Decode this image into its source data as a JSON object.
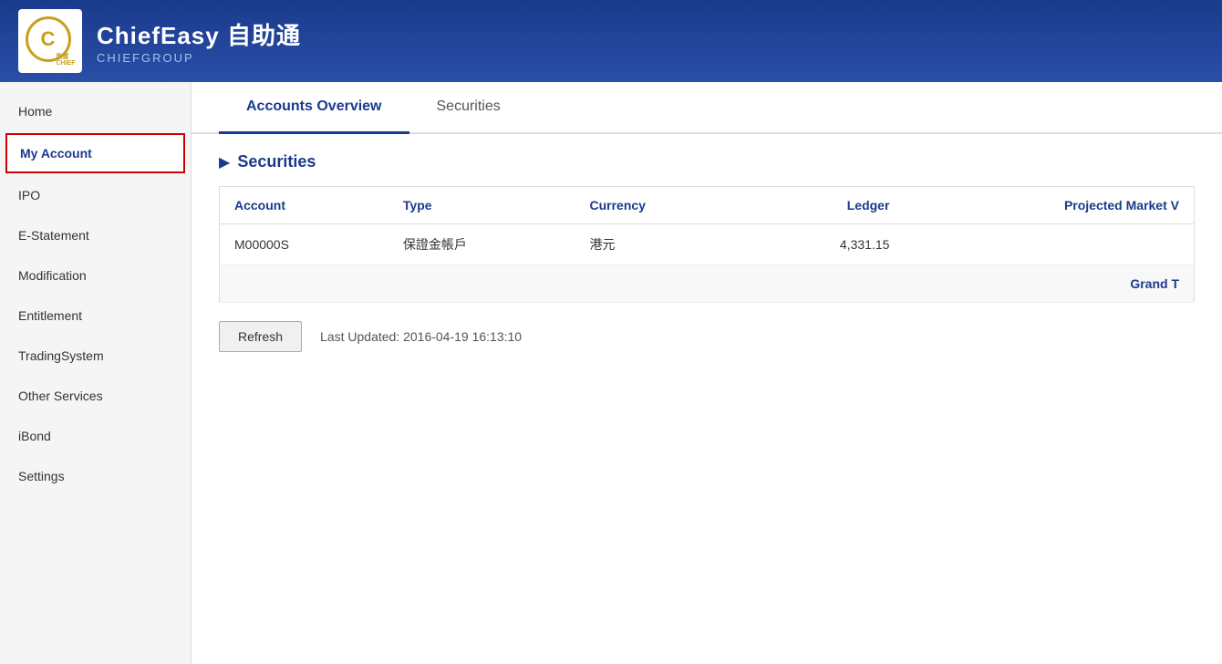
{
  "header": {
    "app_name": "ChiefEasy 自助通",
    "company": "CHIEFGROUP",
    "logo_letter": "C",
    "logo_sub": "致富CHIEF"
  },
  "sidebar": {
    "items": [
      {
        "id": "home",
        "label": "Home",
        "active": false
      },
      {
        "id": "my-account",
        "label": "My Account",
        "active": true
      },
      {
        "id": "ipo",
        "label": "IPO",
        "active": false
      },
      {
        "id": "e-statement",
        "label": "E-Statement",
        "active": false
      },
      {
        "id": "modification",
        "label": "Modification",
        "active": false
      },
      {
        "id": "entitlement",
        "label": "Entitlement",
        "active": false
      },
      {
        "id": "trading-system",
        "label": "TradingSystem",
        "active": false
      },
      {
        "id": "other-services",
        "label": "Other Services",
        "active": false
      },
      {
        "id": "ibond",
        "label": "iBond",
        "active": false
      },
      {
        "id": "settings",
        "label": "Settings",
        "active": false
      }
    ]
  },
  "tabs": [
    {
      "id": "accounts-overview",
      "label": "Accounts Overview",
      "active": true
    },
    {
      "id": "securities",
      "label": "Securities",
      "active": false
    }
  ],
  "section": {
    "arrow": "▶",
    "title": "Securities"
  },
  "table": {
    "columns": [
      {
        "id": "account",
        "label": "Account",
        "align": "left"
      },
      {
        "id": "type",
        "label": "Type",
        "align": "left"
      },
      {
        "id": "currency",
        "label": "Currency",
        "align": "left"
      },
      {
        "id": "ledger",
        "label": "Ledger",
        "align": "right"
      },
      {
        "id": "projected-market",
        "label": "Projected Market V",
        "align": "right"
      }
    ],
    "rows": [
      {
        "account": "M00000S",
        "type": "保證金帳戶",
        "currency": "港元",
        "ledger": "4,331.15",
        "projected_market": ""
      }
    ],
    "grand_total_label": "Grand T"
  },
  "footer": {
    "refresh_label": "Refresh",
    "last_updated_label": "Last Updated: 2016-04-19 16:13:10"
  }
}
